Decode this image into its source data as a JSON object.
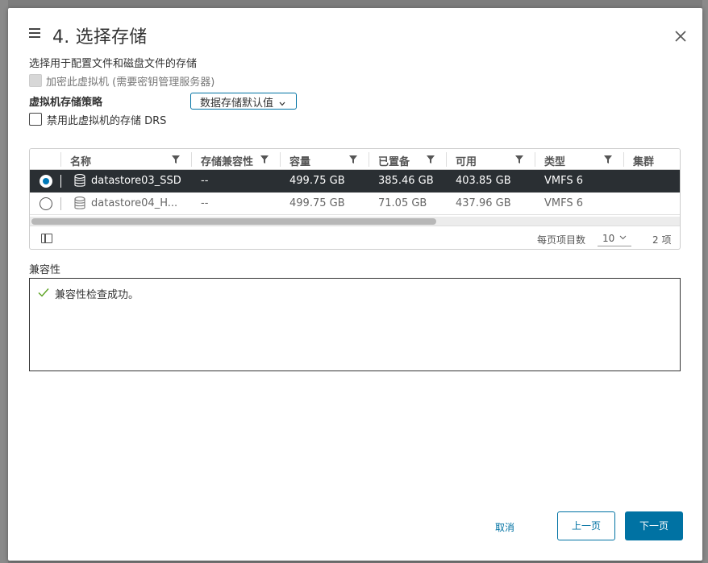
{
  "dialog": {
    "title": "4. 选择存储",
    "subtitle": "选择用于配置文件和磁盘文件的存储"
  },
  "encrypt": {
    "label": "加密此虚拟机 (需要密钥管理服务器)",
    "checked": false,
    "disabled": true
  },
  "policy": {
    "label": "虚拟机存储策略",
    "value": "数据存储默认值"
  },
  "disable_drs": {
    "label": "禁用此虚拟机的存储 DRS",
    "checked": false
  },
  "table": {
    "columns": [
      "名称",
      "存储兼容性",
      "容量",
      "已置备",
      "可用",
      "类型",
      "集群"
    ],
    "rows": [
      {
        "name": "datastore03_SSD",
        "compat": "--",
        "capacity": "499.75 GB",
        "provisioned": "385.46 GB",
        "free": "403.85 GB",
        "type": "VMFS 6",
        "cluster": "",
        "selected": true
      },
      {
        "name": "datastore04_H...",
        "compat": "--",
        "capacity": "499.75 GB",
        "provisioned": "71.05 GB",
        "free": "437.96 GB",
        "type": "VMFS 6",
        "cluster": "",
        "selected": false
      }
    ],
    "footer": {
      "per_page_label": "每页项目数",
      "per_page_value": "10",
      "item_count": "2 项"
    }
  },
  "compatibility": {
    "title": "兼容性",
    "message": "兼容性检查成功。"
  },
  "buttons": {
    "cancel": "取消",
    "back": "上一页",
    "next": "下一页"
  },
  "colors": {
    "accent": "#0072a3",
    "selected_row": "#2a2f33",
    "success": "#5aa220"
  }
}
